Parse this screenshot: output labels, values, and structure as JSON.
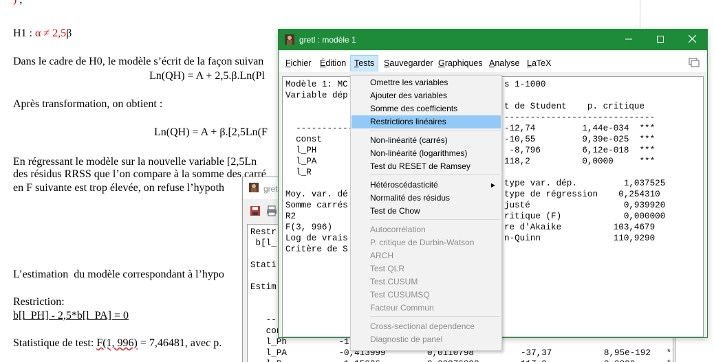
{
  "doc": {
    "h1_label": "H1 : ",
    "h1_formula": "α ≠ 2,5",
    "h1_tail": "β",
    "para1": "Dans le cadre de H0, le modèle s’écrit de la façon suivan",
    "eq1": "Ln(QH) = A + 2,5.β.Ln(Pl",
    "para2": "Après transformation, on obtient :",
    "eq2": "Ln(QH) = A + β.[2,5Ln(F",
    "para3_l1": "En régressant le modèle sur la nouvelle variable [2,5Ln",
    "para3_l2": "des résidus RRSS que l’on compare à la somme des carré",
    "para3_l3": "en F suivante est trop élevée, on refuse l’hypoth",
    "para4": "L’estimation  du modèle correspondant à l’hypo",
    "restriction_label": "Restriction:",
    "restriction_expr": "b[l_PH] - 2,5*b[l_PA] = 0",
    "stat_prefix": "Statistique de test: ",
    "stat_f": "F(1, 996)",
    "stat_rest": " = 7,46481, avec p."
  },
  "window_back": {
    "title": "gretl",
    "lines": [
      "Restr",
      " b[l_",
      "",
      "Stati",
      "",
      "Estim",
      "",
      "",
      "   --",
      "   con",
      "   l_Ph          -1,0",
      "   l_PA          -0,413999        0,0110798         -37,37          8,95e-192   ***",
      "   l_R            1,15026         0,00976099        117,8           0,0000      ***"
    ]
  },
  "window_main": {
    "title": "gretl : modèle 1",
    "menus": [
      {
        "u": "F",
        "rest": "ichier"
      },
      {
        "u": "É",
        "rest": "dition"
      },
      {
        "u": "T",
        "rest": "ests"
      },
      {
        "u": "S",
        "rest": "auvegarder"
      },
      {
        "u": "G",
        "rest": "raphiques"
      },
      {
        "u": "A",
        "rest": "nalyse"
      },
      {
        "u": "L",
        "rest": "aTeX"
      }
    ],
    "left_lines": [
      "Modèle 1: MC",
      "Variable dép",
      "",
      "",
      "  -------------",
      "  const",
      "  l_PH",
      "  l_PA",
      "  l_R",
      "",
      "Moy. var. dé",
      "Somme carrés",
      "R2",
      "F(3, 996)",
      "Log de vrais",
      "Critère de S"
    ],
    "right_lines": [
      "s 1-1000",
      "",
      "t de Student    p. critique",
      "-----------------------------",
      "-12,74         1,44e-034  ***",
      "-10,55         9,39e-025  ***",
      " -8,796        6,12e-018  ***",
      "118,2          0,0000     ***",
      "",
      "type var. dép.         1,037525",
      "type de régression    0,254310",
      "justé                  0,939920",
      "ritique (F)            0,000000",
      "re d'Akaike          103,4679",
      "n-Quinn              110,9290"
    ]
  },
  "dropdown": {
    "items": [
      {
        "label": "Omettre les variables",
        "state": "enabled"
      },
      {
        "label": "Ajouter des variables",
        "state": "enabled"
      },
      {
        "label": "Somme des coefficients",
        "state": "enabled"
      },
      {
        "label": "Restrictions linéaires",
        "state": "highlighted"
      },
      {
        "label": "Non-linéarité (carrés)",
        "state": "enabled"
      },
      {
        "label": "Non-linéarité (logarithmes)",
        "state": "enabled"
      },
      {
        "label": "Test du RESET de Ramsey",
        "state": "enabled"
      },
      {
        "label": "Hétéroscédasticité",
        "state": "enabled",
        "submenu": true
      },
      {
        "label": "Normalité des résidus",
        "state": "enabled"
      },
      {
        "label": "Test de Chow",
        "state": "enabled"
      },
      {
        "label": "Autocorrélation",
        "state": "disabled"
      },
      {
        "label": "P. critique de Durbin-Watson",
        "state": "disabled"
      },
      {
        "label": "ARCH",
        "state": "disabled"
      },
      {
        "label": "Test QLR",
        "state": "disabled"
      },
      {
        "label": "Test CUSUM",
        "state": "disabled"
      },
      {
        "label": "Test CUSUMSQ",
        "state": "disabled"
      },
      {
        "label": "Facteur Commun",
        "state": "disabled"
      },
      {
        "label": "Cross-sectional dependence",
        "state": "disabled"
      },
      {
        "label": "Diagnostic de panel",
        "state": "disabled"
      }
    ]
  },
  "colors": {
    "titlebar": "#1e8b3a",
    "menu_highlight": "#91c9f7",
    "formula_red": "#e00000"
  },
  "icons": {
    "app": "gretl-app-icon",
    "minimize": "minimize-icon",
    "maximize": "maximize-icon",
    "close": "close-icon",
    "copy": "copy-icon",
    "save": "save-icon",
    "print": "print-icon"
  }
}
